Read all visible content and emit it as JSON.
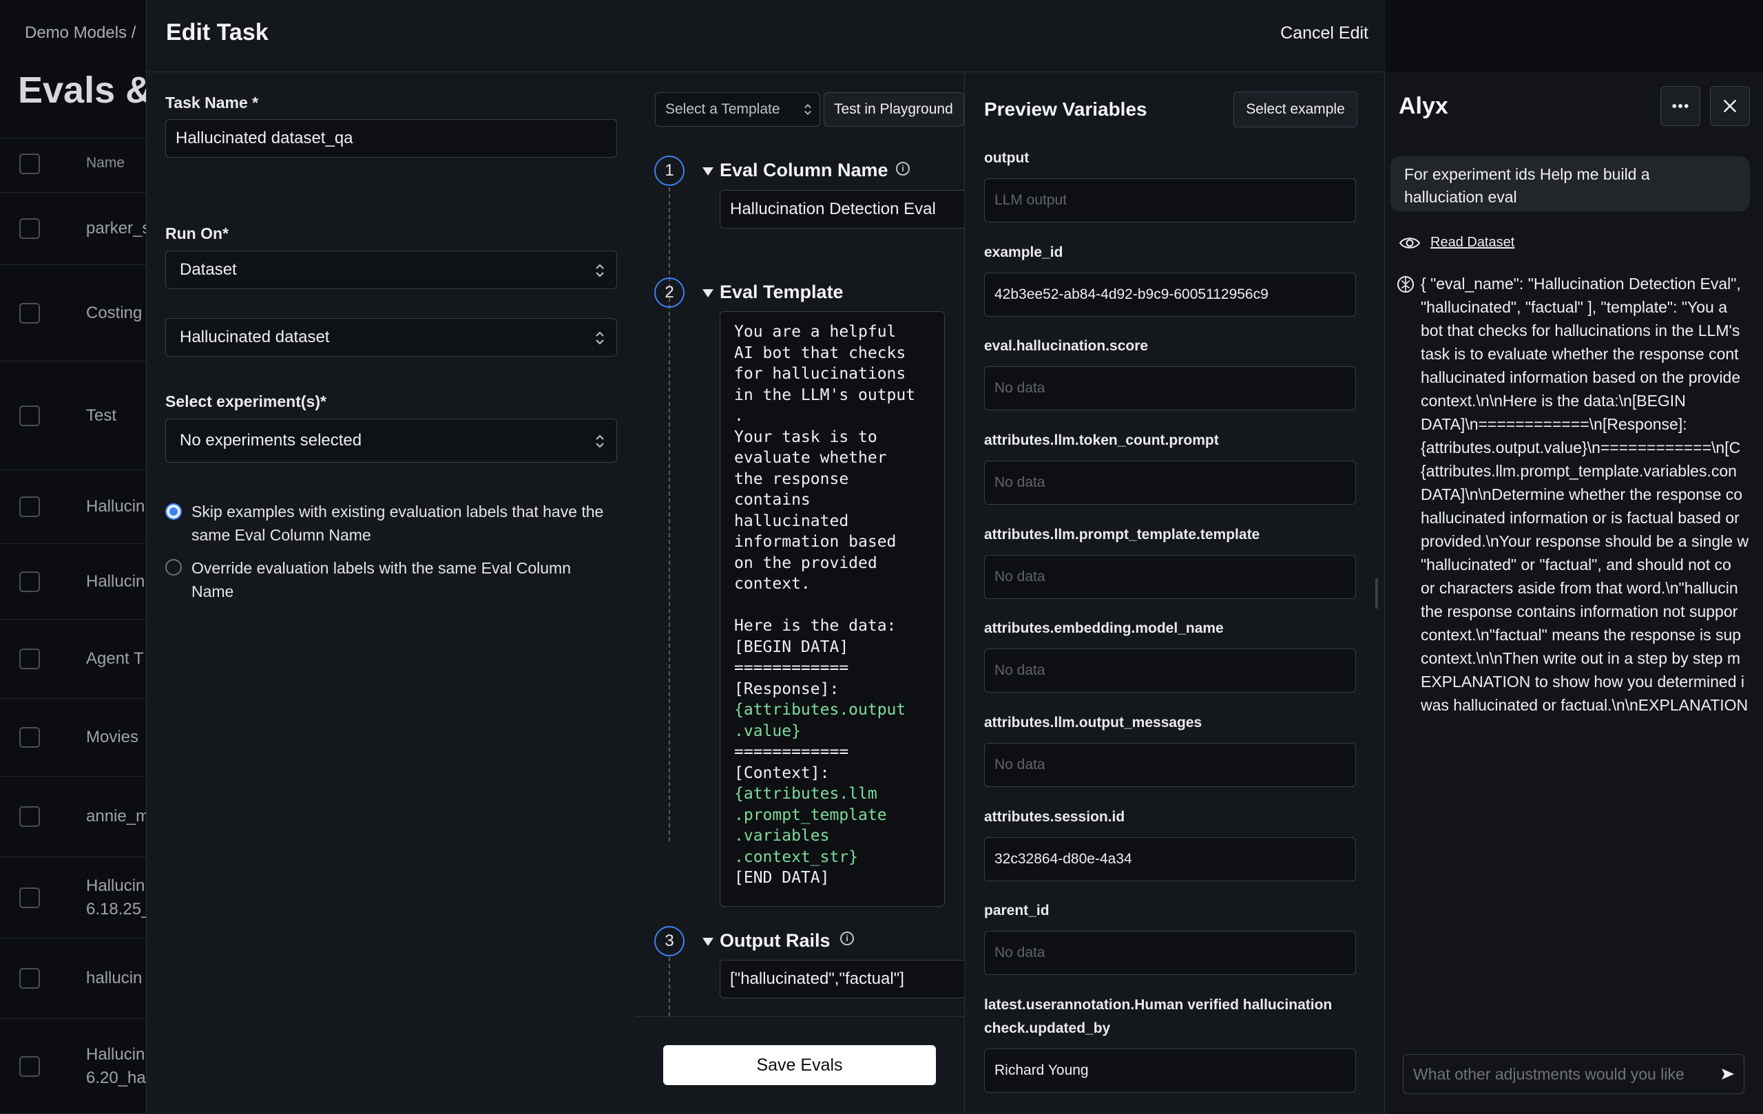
{
  "background": {
    "breadcrumb": "Demo Models /",
    "title": "Evals &",
    "table_header": "Name",
    "rows": [
      {
        "name": "parker_s"
      },
      {
        "name": "Costing"
      },
      {
        "name": "Test"
      },
      {
        "name": "Hallucin"
      },
      {
        "name": "Hallucin"
      },
      {
        "name": "Agent T"
      },
      {
        "name": "Movies"
      },
      {
        "name": "annie_m"
      },
      {
        "name": "Hallucin\n6.18.25_"
      },
      {
        "name": "hallucin"
      },
      {
        "name": "Hallucin\n6.20_ha"
      }
    ]
  },
  "modal": {
    "title": "Edit Task",
    "cancel_label": "Cancel Edit"
  },
  "form": {
    "task_name_label": "Task Name *",
    "task_name_value": "Hallucinated dataset_qa",
    "run_on_label": "Run On*",
    "run_on_value": "Dataset",
    "dataset_value": "Hallucinated dataset",
    "experiments_label": "Select experiment(s)*",
    "experiments_value": "No experiments selected",
    "skip_option": "Skip examples with existing evaluation labels that have the same Eval Column Name",
    "override_option": "Override evaluation labels with the same Eval Column Name",
    "skip_selected": true
  },
  "eval": {
    "template_select": "Select a Template",
    "playground_label": "Test in Playground",
    "steps": [
      {
        "number": "1",
        "title": "Eval Column Name"
      },
      {
        "number": "2",
        "title": "Eval Template"
      },
      {
        "number": "3",
        "title": "Output Rails"
      }
    ],
    "column_name_value": "Hallucination Detection Eval",
    "template_lines_1": "You are a helpful\nAI bot that checks\nfor hallucinations\nin the LLM's output\n.\nYour task is to\nevaluate whether\nthe response\ncontains\nhallucinated\ninformation based\non the provided\ncontext.\n\nHere is the data:\n[BEGIN DATA]\n============\n[Response]:\n",
    "template_var_1": "{attributes.output\n.value}",
    "template_lines_2": "\n============\n[Context]:\n",
    "template_var_2": "{attributes.llm\n.prompt_template\n.variables\n.context_str}",
    "template_lines_3": "\n[END DATA]",
    "output_rails_value": "[\"hallucinated\",\"factual\"]",
    "save_label": "Save Evals"
  },
  "preview": {
    "title": "Preview Variables",
    "select_example_label": "Select example",
    "variables": [
      {
        "label": "output",
        "value": "LLM output",
        "placeholder": true
      },
      {
        "label": "example_id",
        "value": "42b3ee52-ab84-4d92-b9c9-6005112956c9",
        "placeholder": false
      },
      {
        "label": "eval.hallucination.score",
        "value": "No data",
        "placeholder": true
      },
      {
        "label": "attributes.llm.token_count.prompt",
        "value": "No data",
        "placeholder": true
      },
      {
        "label": "attributes.llm.prompt_template.template",
        "value": "No data",
        "placeholder": true
      },
      {
        "label": "attributes.embedding.model_name",
        "value": "No data",
        "placeholder": true
      },
      {
        "label": "attributes.llm.output_messages",
        "value": "No data",
        "placeholder": true
      },
      {
        "label": "attributes.session.id",
        "value": "32c32864-d80e-4a34",
        "placeholder": false
      },
      {
        "label": "parent_id",
        "value": "No data",
        "placeholder": true
      },
      {
        "label": "latest.userannotation.Human verified hallucination\ncheck.updated_by",
        "value": "Richard Young",
        "placeholder": false
      }
    ]
  },
  "alyx": {
    "title": "Alyx",
    "user_message": "For experiment ids Help me build a\nhalluciation eval",
    "tool_call_label": "Read Dataset",
    "response_text": "{ \"eval_name\": \"Hallucination Detection Eval\",\n\"hallucinated\", \"factual\" ], \"template\": \"You a\nbot that checks for hallucinations in the LLM's\ntask is to evaluate whether the response cont\nhallucinated information based on the provide\ncontext.\\n\\nHere is the data:\\n[BEGIN\nDATA]\\n============\\n[Response]:\n{attributes.output.value}\\n============\\n[C\n{attributes.llm.prompt_template.variables.con\nDATA]\\n\\nDetermine whether the response co\nhallucinated information or is factual based or\nprovided.\\nYour response should be a single w\n\"hallucinated\" or \"factual\", and should not co\nor characters aside from that word.\\n\"hallucin\nthe response contains information not suppor\ncontext.\\n\"factual\" means the response is sup\ncontext.\\n\\nThen write out in a step by step m\nEXPLANATION to show how you determined i\nwas hallucinated or factual.\\n\\nEXPLANATION",
    "chat_placeholder": "What other adjustments would you like"
  }
}
